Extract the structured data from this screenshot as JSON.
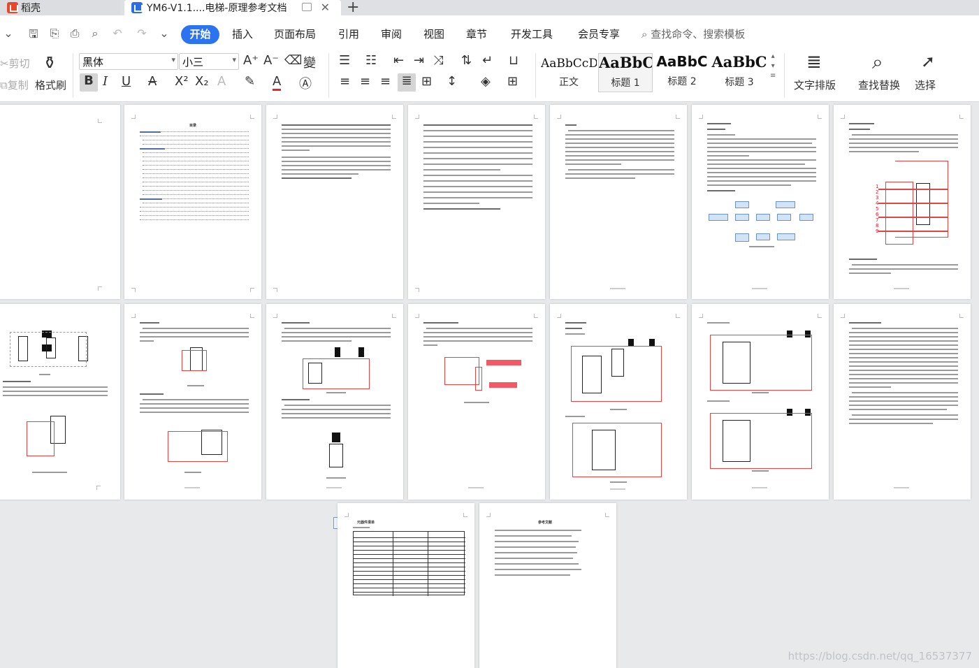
{
  "tabs": {
    "inactive_label": "稻壳",
    "active_label": "YM6-V1.1....电梯-原理参考文档"
  },
  "menu": {
    "items": [
      "开始",
      "插入",
      "页面布局",
      "引用",
      "审阅",
      "视图",
      "章节",
      "开发工具",
      "会员专享"
    ],
    "search_placeholder": "查找命令、搜索模板"
  },
  "ribbon": {
    "cut": "剪切",
    "copy": "复制",
    "format_painter": "格式刷",
    "font_name": "黑体",
    "font_size": "小三",
    "styles": [
      {
        "sample": "AaBbCcDd",
        "name": "正文"
      },
      {
        "sample": "AaBbC",
        "name": "标题 1"
      },
      {
        "sample": "AaBbC",
        "name": "标题 2"
      },
      {
        "sample": "AaBbC",
        "name": "标题 3"
      }
    ],
    "text_layout": "文字排版",
    "find_replace": "查找替换",
    "select": "选择"
  },
  "document": {
    "toc_title": "目录",
    "references_title": "参考文献",
    "table_title": "元器件清单"
  },
  "watermark": "https://blog.csdn.net/qq_16537377",
  "colors": {
    "accent": "#2b73f1",
    "workspace": "#e8e9eb",
    "circuit_red": "#e34444"
  }
}
